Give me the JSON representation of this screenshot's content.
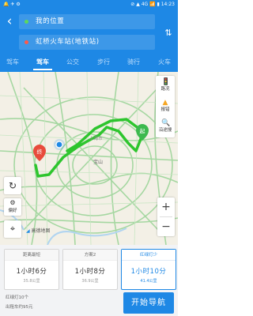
{
  "status": {
    "left": "🔔 ✈ ⚙",
    "right": "⊘ ▲ 4G 📶 ▮ 14:23"
  },
  "header": {
    "start": "我的位置",
    "end": "虹桥火车站(地铁站)",
    "back_icon": "‹",
    "swap_icon": "⇅"
  },
  "tabs": [
    {
      "label": "驾车"
    },
    {
      "label": "驾车"
    },
    {
      "label": "公交"
    },
    {
      "label": "步行"
    },
    {
      "label": "骑行"
    },
    {
      "label": "火车"
    }
  ],
  "map": {
    "traffic_label": "路况",
    "report_label": "报错",
    "around_label": "沿途搜",
    "prefer_label": "偏好",
    "start_marker": "起",
    "end_marker": "终",
    "map_label_a": "上海市",
    "map_label_b": "宝山",
    "scale": "高德地图"
  },
  "routes": [
    {
      "name": "距离最短",
      "duration": "1小时6分",
      "distance": "35.8公里"
    },
    {
      "name": "方案2",
      "duration": "1小时8分",
      "distance": "36.9公里"
    },
    {
      "name": "红绿灯少",
      "duration": "1小时10分",
      "distance": "41.4公里"
    }
  ],
  "summary": {
    "lights": "红绿灯10个",
    "taxi": "出租车约95元"
  },
  "nav_button": "开始导航",
  "colors": {
    "primary": "#1e88e5",
    "route": "#2ec52e",
    "start": "#3cb94e",
    "end": "#e84b3c"
  }
}
